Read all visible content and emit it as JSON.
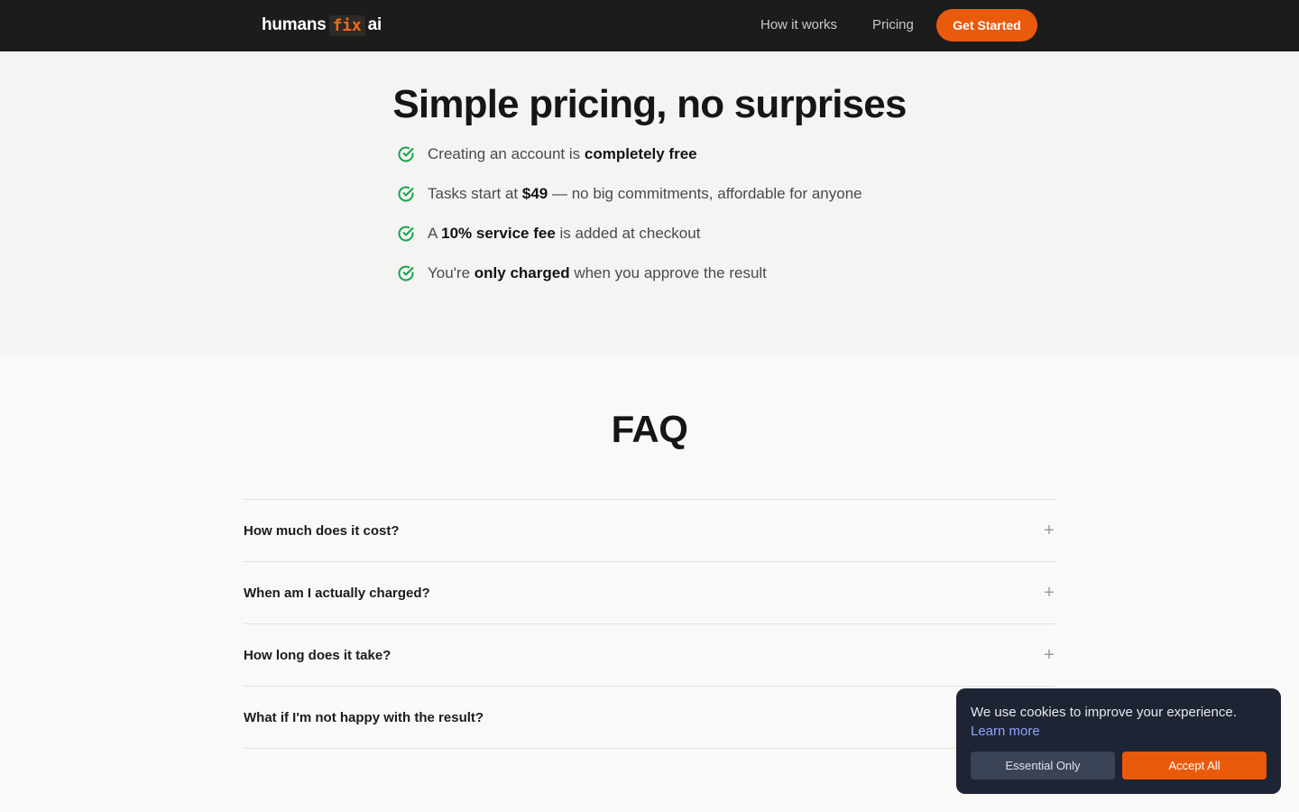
{
  "nav": {
    "logo": {
      "part1": "humans",
      "part2": "fix",
      "part3": "ai"
    },
    "links": [
      "How it works",
      "Pricing"
    ],
    "cta": "Get Started"
  },
  "pricing": {
    "title": "Simple pricing, no surprises",
    "bullets": [
      {
        "before": "Creating an account is ",
        "bold": "completely free",
        "after": ""
      },
      {
        "before": "Tasks start at ",
        "bold": "$49",
        "after": " — no big commitments, affordable for anyone"
      },
      {
        "before": "A ",
        "bold": "10% service fee",
        "after": " is added at checkout"
      },
      {
        "before": "You're ",
        "bold": "only charged",
        "after": " when you approve the result"
      }
    ]
  },
  "faq": {
    "title": "FAQ",
    "items": [
      {
        "question": "How much does it cost?",
        "toggle": "+"
      },
      {
        "question": "When am I actually charged?",
        "toggle": "+"
      },
      {
        "question": "How long does it take?",
        "toggle": "+"
      },
      {
        "question": "What if I'm not happy with the result?",
        "toggle": "+"
      }
    ]
  },
  "cookie": {
    "message": "We use cookies to improve your experience.",
    "link": "Learn more",
    "essential_label": "Essential Only",
    "accept_label": "Accept All"
  },
  "colors": {
    "accent": "#ea5a0c",
    "check_green": "#16a34a",
    "nav_bg": "#1c1c1c",
    "cookie_bg": "#1e2433"
  },
  "icons": {
    "check": "check-circle-icon",
    "plus": "plus-icon"
  }
}
